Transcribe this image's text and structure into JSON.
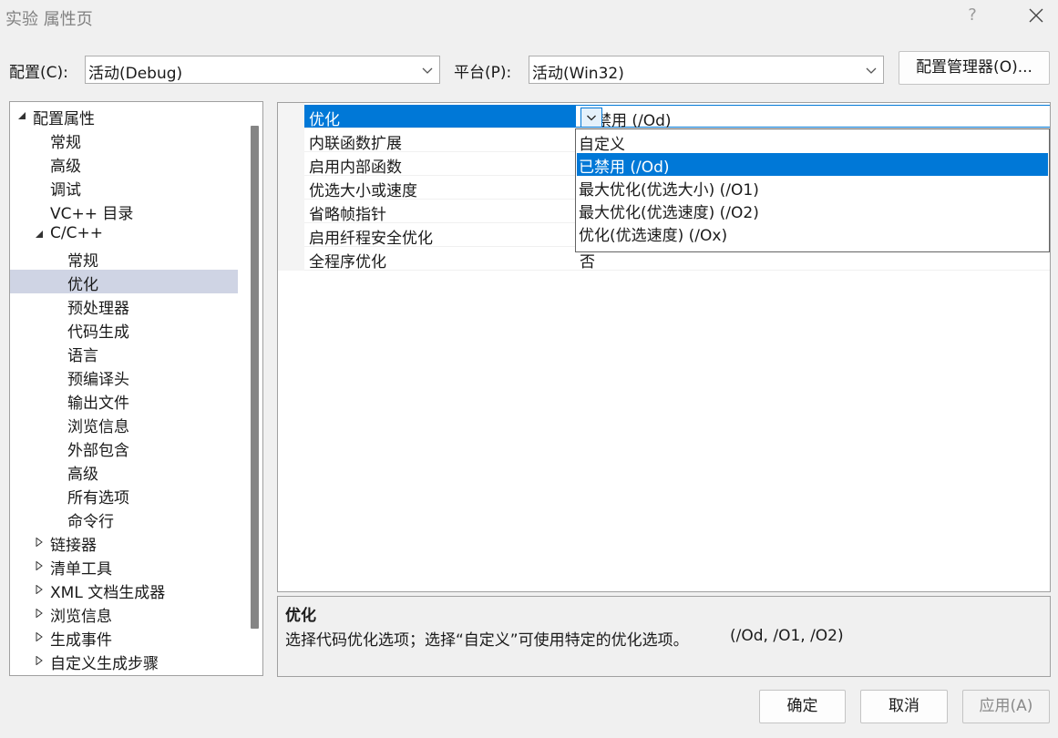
{
  "window": {
    "title": "实验 属性页",
    "help_label": "?",
    "close_icon": "close-icon"
  },
  "config_bar": {
    "config_label": "配置(C):",
    "config_value": "活动(Debug)",
    "platform_label": "平台(P):",
    "platform_value": "活动(Win32)",
    "manager_button": "配置管理器(O)..."
  },
  "tree": {
    "items": [
      {
        "label": "配置属性",
        "indent": 0,
        "expanded": true
      },
      {
        "label": "常规",
        "indent": 1
      },
      {
        "label": "高级",
        "indent": 1
      },
      {
        "label": "调试",
        "indent": 1
      },
      {
        "label": "VC++ 目录",
        "indent": 1
      },
      {
        "label": "C/C++",
        "indent": 1,
        "expanded": true
      },
      {
        "label": "常规",
        "indent": 2
      },
      {
        "label": "优化",
        "indent": 2,
        "selected": true
      },
      {
        "label": "预处理器",
        "indent": 2
      },
      {
        "label": "代码生成",
        "indent": 2
      },
      {
        "label": "语言",
        "indent": 2
      },
      {
        "label": "预编译头",
        "indent": 2
      },
      {
        "label": "输出文件",
        "indent": 2
      },
      {
        "label": "浏览信息",
        "indent": 2
      },
      {
        "label": "外部包含",
        "indent": 2
      },
      {
        "label": "高级",
        "indent": 2
      },
      {
        "label": "所有选项",
        "indent": 2
      },
      {
        "label": "命令行",
        "indent": 2
      },
      {
        "label": "链接器",
        "indent": 1,
        "collapsed": true
      },
      {
        "label": "清单工具",
        "indent": 1,
        "collapsed": true
      },
      {
        "label": "XML 文档生成器",
        "indent": 1,
        "collapsed": true
      },
      {
        "label": "浏览信息",
        "indent": 1,
        "collapsed": true
      },
      {
        "label": "生成事件",
        "indent": 1,
        "collapsed": true
      },
      {
        "label": "自定义生成步骤",
        "indent": 1,
        "collapsed": true
      }
    ]
  },
  "properties": {
    "rows": [
      {
        "name": "优化",
        "value": "已禁用 (/Od)",
        "selected": true
      },
      {
        "name": "内联函数扩展",
        "value": ""
      },
      {
        "name": "启用内部函数",
        "value": ""
      },
      {
        "name": "优选大小或速度",
        "value": ""
      },
      {
        "name": "省略帧指针",
        "value": ""
      },
      {
        "name": "启用纤程安全优化",
        "value": ""
      },
      {
        "name": "全程序优化",
        "value": "否"
      }
    ]
  },
  "dropdown": {
    "options": [
      {
        "label": "自定义"
      },
      {
        "label": "已禁用 (/Od)",
        "selected": true
      },
      {
        "label": "最大优化(优选大小) (/O1)"
      },
      {
        "label": "最大优化(优选速度) (/O2)"
      },
      {
        "label": "优化(优选速度) (/Ox)"
      }
    ]
  },
  "description": {
    "title": "优化",
    "text": "选择代码优化选项；选择“自定义”可使用特定的优化选项。",
    "switches": "(/Od, /O1, /O2)"
  },
  "buttons": {
    "ok": "确定",
    "cancel": "取消",
    "apply": "应用(A)"
  },
  "colors": {
    "selection_blue": "#0078d7",
    "tree_selection": "#cfd4e4",
    "window_bg": "#f0f0f0"
  }
}
